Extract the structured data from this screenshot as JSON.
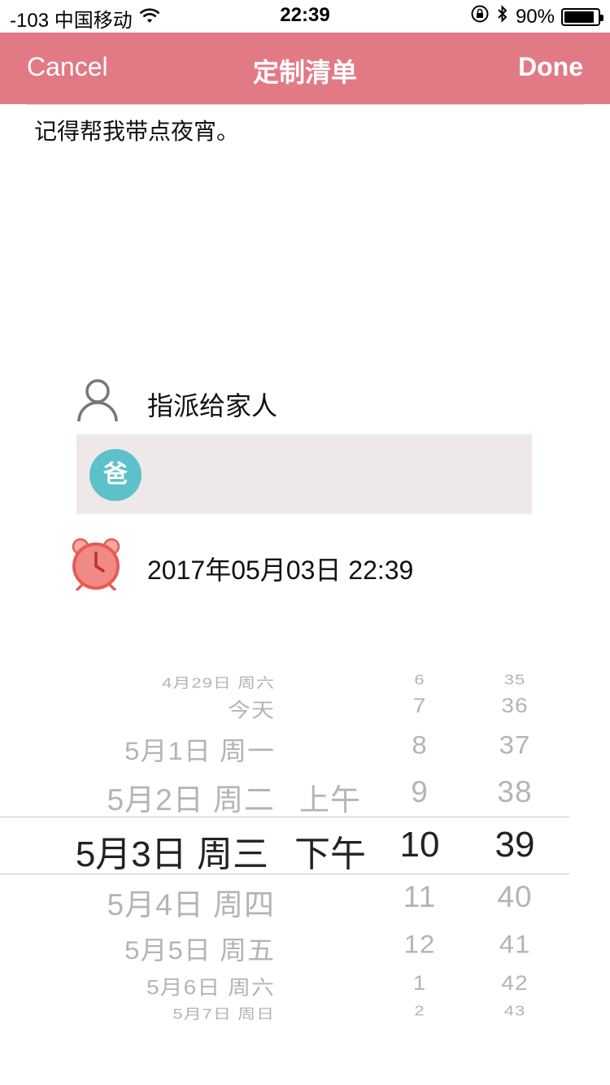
{
  "status": {
    "carrier": "-103 中国移动",
    "time": "22:39",
    "battery": "90%",
    "battery_level": 0.9
  },
  "nav": {
    "cancel": "Cancel",
    "title": "定制清单",
    "done": "Done"
  },
  "note": {
    "text": "记得帮我带点夜宵。"
  },
  "assign": {
    "label": "指派给家人",
    "member_initial": "爸"
  },
  "alarm": {
    "datetime": "2017年05月03日 22:39"
  },
  "picker": {
    "rows": [
      {
        "date": "4月29日 周六",
        "ampm": "",
        "hour": "6",
        "minute": "35"
      },
      {
        "date": "今天",
        "ampm": "",
        "hour": "7",
        "minute": "36"
      },
      {
        "date": "5月1日 周一",
        "ampm": "",
        "hour": "8",
        "minute": "37"
      },
      {
        "date": "5月2日 周二",
        "ampm": "上午",
        "hour": "9",
        "minute": "38"
      },
      {
        "date": "5月3日 周三",
        "ampm": "下午",
        "hour": "10",
        "minute": "39"
      },
      {
        "date": "5月4日 周四",
        "ampm": "",
        "hour": "11",
        "minute": "40"
      },
      {
        "date": "5月5日 周五",
        "ampm": "",
        "hour": "12",
        "minute": "41"
      },
      {
        "date": "5月6日 周六",
        "ampm": "",
        "hour": "1",
        "minute": "42"
      },
      {
        "date": "5月7日 周日",
        "ampm": "",
        "hour": "2",
        "minute": "43"
      }
    ]
  },
  "colors": {
    "nav_bg": "#e27a86",
    "member_avatar": "#5dc1cb",
    "member_box_bg": "#efe8e8",
    "alarm": "#e85a58"
  }
}
